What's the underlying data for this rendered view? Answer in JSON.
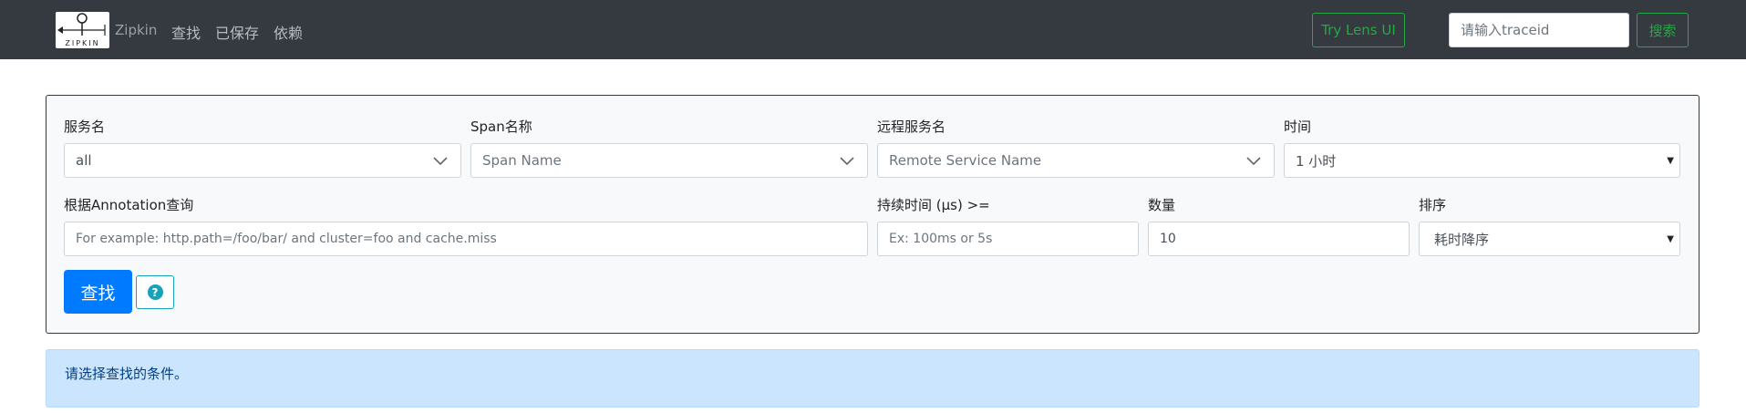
{
  "navbar": {
    "brand_name": "Zipkin",
    "logo_text": "ZIPKIN",
    "links": [
      "查找",
      "已保存",
      "依赖"
    ],
    "lens_button": "Try Lens UI",
    "traceid_placeholder": "请输入traceid",
    "search_button": "搜索"
  },
  "query": {
    "service_name": {
      "label": "服务名",
      "value": "all"
    },
    "span_name": {
      "label": "Span名称",
      "placeholder": "Span Name"
    },
    "remote_service": {
      "label": "远程服务名",
      "placeholder": "Remote Service Name"
    },
    "time": {
      "label": "时间",
      "value": "1 小时"
    },
    "annotation": {
      "label": "根据Annotation查询",
      "placeholder": "For example: http.path=/foo/bar/ and cluster=foo and cache.miss"
    },
    "duration": {
      "label": "持续时间 (μs) >=",
      "placeholder": "Ex: 100ms or 5s"
    },
    "limit": {
      "label": "数量",
      "value": "10"
    },
    "sort": {
      "label": "排序",
      "value": "耗时降序"
    },
    "find_button": "查找",
    "help_icon": "question-circle-icon"
  },
  "alert": {
    "message": "请选择查找的条件。"
  },
  "colors": {
    "navbar_bg": "#343a40",
    "success": "#28a745",
    "primary": "#007bff",
    "info": "#17a2b8",
    "alert_bg": "#cce5ff"
  }
}
